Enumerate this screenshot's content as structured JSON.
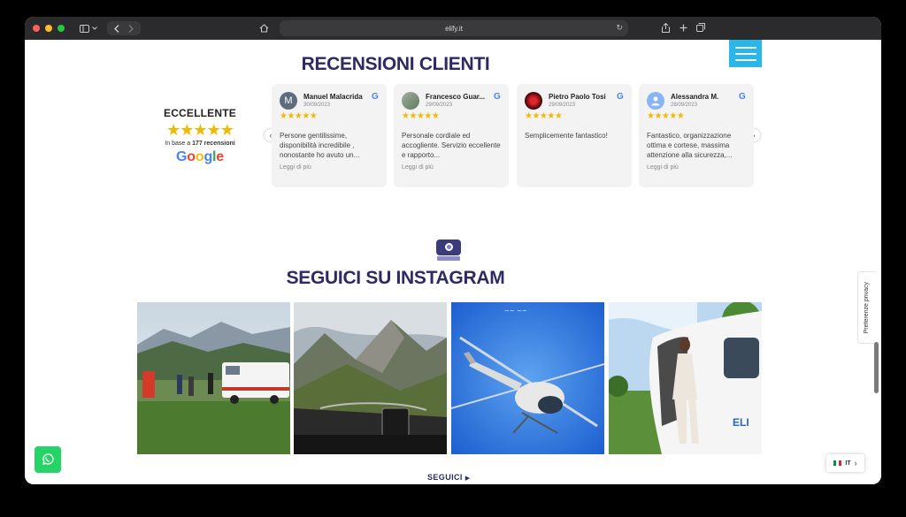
{
  "browser": {
    "url": "elify.it"
  },
  "reviews": {
    "title": "RECENSIONI CLIENTI",
    "summary": {
      "rating_word": "ECCELLENTE",
      "stars": "★★★★★",
      "based_prefix": "In base a",
      "count": "177 recensioni",
      "logo": [
        "G",
        "o",
        "o",
        "g",
        "l",
        "e"
      ]
    },
    "items": [
      {
        "name": "Manuel Malacrida",
        "date": "30/09/2023",
        "stars": "★★★★★",
        "text": "Persone gentilissime, disponibilità incredibile , nonostante ho avuto un...",
        "more": "Leggi di più",
        "avatar": "M",
        "avatar_color": "#5d6d7e"
      },
      {
        "name": "Francesco Guar...",
        "date": "29/09/2023",
        "stars": "★★★★★",
        "text": "Personale cordiale ed accogliente. Servizio eccellente e rapporto...",
        "more": "Leggi di più",
        "avatar": "",
        "avatar_color": "#7c8e6a"
      },
      {
        "name": "Pietro Paolo Tosi",
        "date": "29/09/2023",
        "stars": "★★★★★",
        "text": "Semplicemente fantastico!",
        "more": "",
        "avatar": "",
        "avatar_color": "#7a0f12"
      },
      {
        "name": "Alessandra M.",
        "date": "28/09/2023",
        "stars": "★★★★★",
        "text": "Fantastico, organizzazione ottima e cortese, massima attenzione alla sicurezza,...",
        "more": "Leggi di più",
        "avatar": "",
        "avatar_color": "#8ab4f8"
      }
    ],
    "prev_icon": "chevron-left-icon",
    "next_icon": "chevron-right-icon"
  },
  "instagram": {
    "title": "SEGUICI SU INSTAGRAM",
    "follow_label": "SEGUICI"
  },
  "privacy_tab": "Preferenze privacy",
  "language": "IT",
  "colors": {
    "title": "#2d2a63",
    "accent": "#29b6e8",
    "star": "#f5b800",
    "whatsapp": "#25d366"
  }
}
